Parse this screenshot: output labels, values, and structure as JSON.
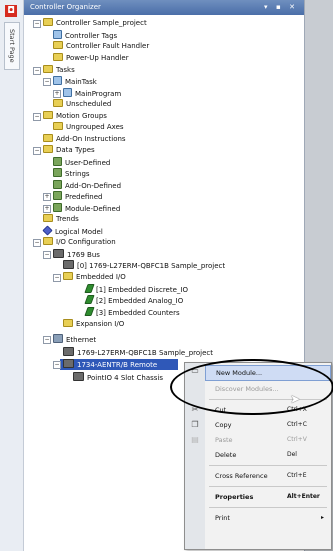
{
  "title": "Controller Organizer",
  "title_buttons": "▾ ▪ ✕",
  "start_page_tab": "Start Page",
  "tree": [
    {
      "label": "Controller Sample_project",
      "icon": "folder"
    },
    {
      "label": "Controller Tags",
      "icon": "doc"
    },
    {
      "label": "Controller Fault Handler",
      "icon": "folder"
    },
    {
      "label": "Power-Up Handler",
      "icon": "folder"
    },
    {
      "label": "Tasks",
      "icon": "folder"
    },
    {
      "label": "MainTask",
      "icon": "doc"
    },
    {
      "label": "MainProgram",
      "icon": "doc"
    },
    {
      "label": "Unscheduled",
      "icon": "folder"
    },
    {
      "label": "Motion Groups",
      "icon": "folder"
    },
    {
      "label": "Ungrouped Axes",
      "icon": "folder"
    },
    {
      "label": "Add-On Instructions",
      "icon": "folder"
    },
    {
      "label": "Data Types",
      "icon": "folder"
    },
    {
      "label": "User-Defined",
      "icon": "dt"
    },
    {
      "label": "Strings",
      "icon": "dt"
    },
    {
      "label": "Add-On-Defined",
      "icon": "dt"
    },
    {
      "label": "Predefined",
      "icon": "dt"
    },
    {
      "label": "Module-Defined",
      "icon": "dt"
    },
    {
      "label": "Trends",
      "icon": "folder"
    },
    {
      "label": "Logical Model",
      "icon": "logi"
    },
    {
      "label": "I/O Configuration",
      "icon": "folder"
    },
    {
      "label": "1769 Bus",
      "icon": "mod"
    },
    {
      "label": "[0] 1769-L27ERM-QBFC1B Sample_project",
      "icon": "mod"
    },
    {
      "label": "Embedded I/O",
      "icon": "folder"
    },
    {
      "label": "[1] Embedded Discrete_IO",
      "icon": "green"
    },
    {
      "label": "[2] Embedded Analog_IO",
      "icon": "green"
    },
    {
      "label": "[3] Embedded Counters",
      "icon": "green"
    },
    {
      "label": "Expansion I/O",
      "icon": "folder"
    },
    {
      "label": "Ethernet",
      "icon": "netw"
    },
    {
      "label": "1769-L27ERM-QBFC1B Sample_project",
      "icon": "mod"
    },
    {
      "label": "1734-AENTR/B Remote",
      "icon": "mod"
    },
    {
      "label": "PointIO 4 Slot Chassis",
      "icon": "mod"
    }
  ],
  "menu": {
    "items": [
      {
        "label": "New Module...",
        "shortcut": "",
        "state": "highlighted"
      },
      {
        "label": "Discover Modules...",
        "shortcut": "",
        "state": "disabled"
      },
      {
        "label": "Cut",
        "shortcut": "Ctrl+X",
        "state": "normal",
        "icon": "cut-icon"
      },
      {
        "label": "Copy",
        "shortcut": "Ctrl+C",
        "state": "normal",
        "icon": "copy-icon"
      },
      {
        "label": "Paste",
        "shortcut": "Ctrl+V",
        "state": "disabled",
        "icon": "paste-icon"
      },
      {
        "label": "Delete",
        "shortcut": "Del",
        "state": "normal"
      },
      {
        "label": "Cross Reference",
        "shortcut": "Ctrl+E",
        "state": "normal"
      },
      {
        "label": "Properties",
        "shortcut": "Alt+Enter",
        "state": "bold"
      },
      {
        "label": "Print",
        "shortcut": "",
        "state": "normal"
      }
    ]
  },
  "colors": {
    "accent": "#2f58b8",
    "title": "#4a6ea8",
    "callout": "#000000"
  }
}
